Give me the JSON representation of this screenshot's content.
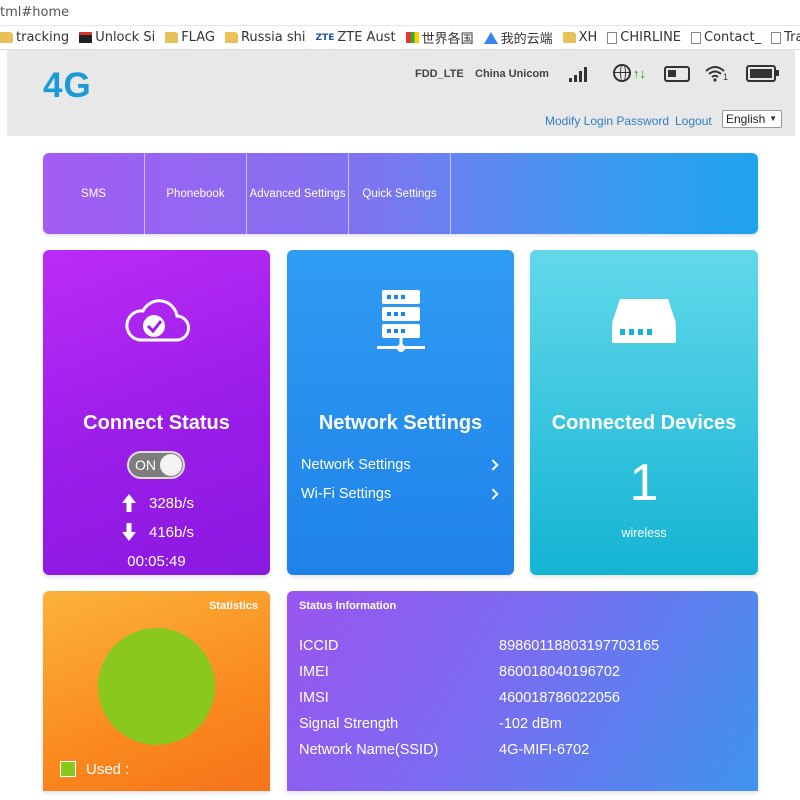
{
  "browser": {
    "url": "tml#home",
    "bookmarks": [
      {
        "label": "tracking",
        "icon": "folder-icon"
      },
      {
        "label": "Unlock Si",
        "icon": "bookmark-page-icon"
      },
      {
        "label": "FLAG",
        "icon": "folder-icon"
      },
      {
        "label": "Russia shi",
        "icon": "folder-icon"
      },
      {
        "label": "ZTE Aust",
        "icon": "zte-logo-icon"
      },
      {
        "label": "世界各国",
        "icon": "colorful-site-icon"
      },
      {
        "label": "我的云端",
        "icon": "drive-icon"
      },
      {
        "label": "XH",
        "icon": "folder-icon"
      },
      {
        "label": "CHIRLINE",
        "icon": "page-icon"
      },
      {
        "label": "Contact_",
        "icon": "page-icon"
      },
      {
        "label": "Tracking",
        "icon": "page-icon"
      }
    ]
  },
  "header": {
    "logo": "4G",
    "network_mode": "FDD_LTE",
    "carrier": "China Unicom",
    "modify_password": "Modify Login Password",
    "logout": "Logout",
    "language": "English",
    "signal_level": 4,
    "wifi_clients": "1"
  },
  "menu": {
    "items": [
      "SMS",
      "Phonebook",
      "Advanced Settings",
      "Quick Settings"
    ]
  },
  "connect": {
    "title": "Connect Status",
    "toggle": "ON",
    "upload": "328b/s",
    "download": "416b/s",
    "duration": "00:05:49"
  },
  "network": {
    "title": "Network Settings",
    "links": [
      "Network Settings",
      "Wi-Fi Settings"
    ]
  },
  "devices": {
    "title": "Connected Devices",
    "count": "1",
    "type": "wireless"
  },
  "statistics": {
    "title": "Statistics",
    "legend_label": "Used  :",
    "used_color": "#8ac81e"
  },
  "status_info": {
    "title": "Status Information",
    "rows": [
      {
        "key": "ICCID",
        "value": "89860118803197703165"
      },
      {
        "key": "IMEI",
        "value": "860018040196702"
      },
      {
        "key": "IMSI",
        "value": "460018786022056"
      },
      {
        "key": "Signal Strength",
        "value": "-102 dBm"
      },
      {
        "key": "Network Name(SSID)",
        "value": "4G-MIFI-6702"
      }
    ]
  },
  "colors": {
    "brand_blue": "#1a9ad6",
    "link_blue": "#2f7ec2",
    "connect_purple": "#9a1de8",
    "network_blue": "#1f82ea",
    "devices_teal": "#14b4d4",
    "stats_orange": "#fa8a1f"
  }
}
